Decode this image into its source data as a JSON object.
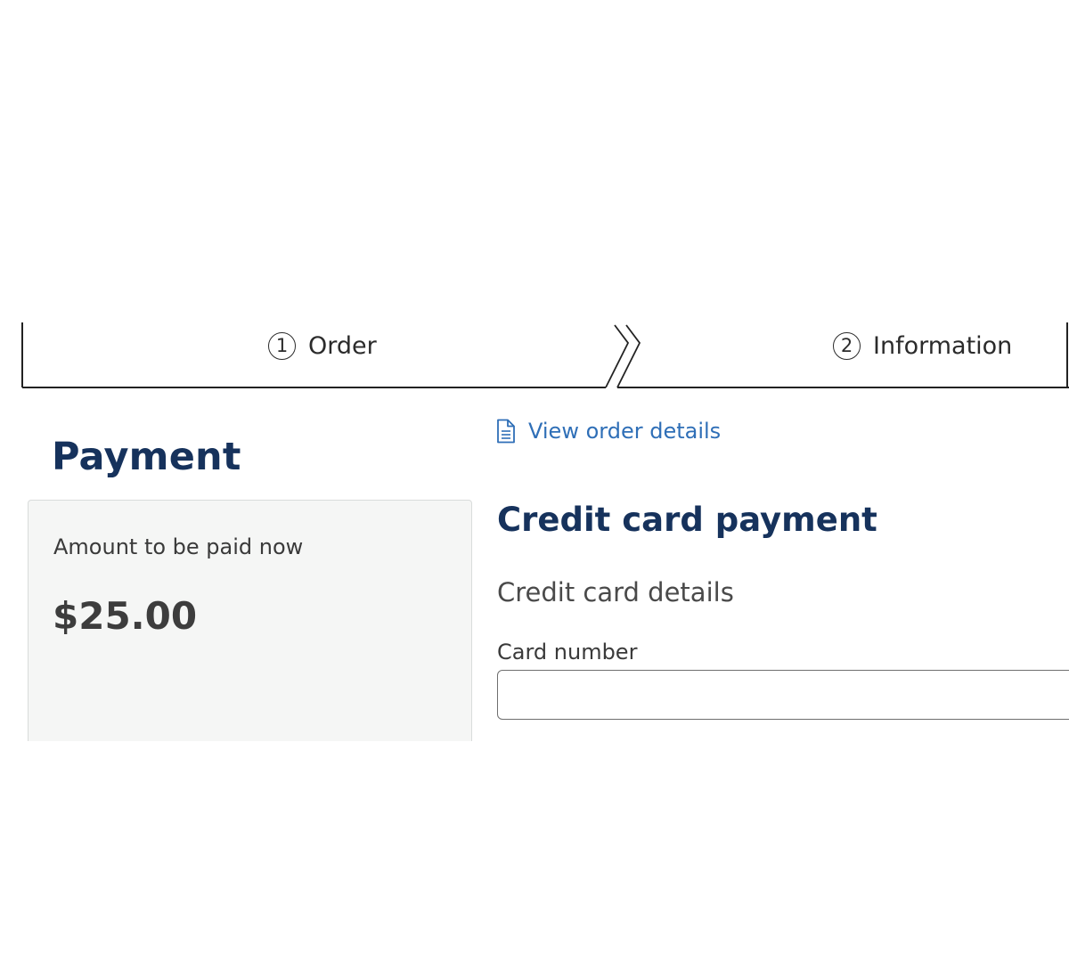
{
  "stepper": {
    "steps": [
      {
        "number": "1",
        "label": "Order"
      },
      {
        "number": "2",
        "label": "Information"
      }
    ]
  },
  "payment": {
    "title": "Payment",
    "amount_label": "Amount to be paid now",
    "amount_value": "$25.00"
  },
  "order_details": {
    "link_label": "View order details",
    "icon": "document-icon"
  },
  "credit_card": {
    "section_title": "Credit card payment",
    "details_title": "Credit card details",
    "card_number_label": "Card number",
    "card_number_value": "",
    "card_number_placeholder": ""
  },
  "colors": {
    "heading": "#16325c",
    "link": "#2f6fb7",
    "card_bg": "#f5f6f5"
  }
}
